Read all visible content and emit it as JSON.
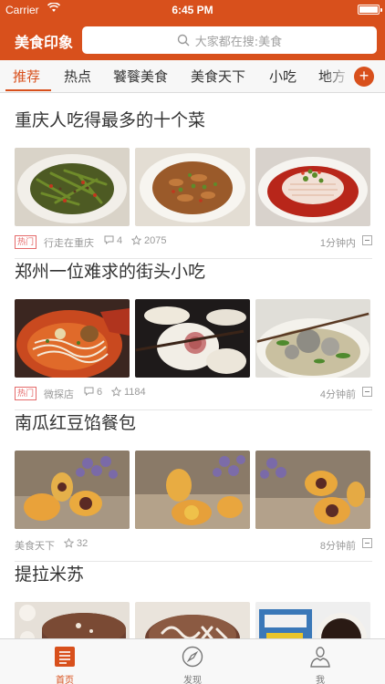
{
  "status_bar": {
    "carrier": "Carrier",
    "time": "6:45 PM"
  },
  "app": {
    "title": "美食印象"
  },
  "search": {
    "placeholder": "大家都在搜:美食"
  },
  "tabs": [
    {
      "label": "推荐",
      "active": true
    },
    {
      "label": "热点"
    },
    {
      "label": "饕餮美食"
    },
    {
      "label": "美食天下"
    },
    {
      "label": "小吃"
    },
    {
      "label": "地方"
    }
  ],
  "add_tab_label": "+",
  "articles": [
    {
      "title": "重庆人吃得最多的十个菜",
      "badge": "热门",
      "source": "行走在重庆",
      "comments": "4",
      "stars": "2075",
      "time": "1分钟内"
    },
    {
      "title": "郑州一位难求的街头小吃",
      "badge": "热门",
      "source": "微探店",
      "comments": "6",
      "stars": "1184",
      "time": "4分钟前"
    },
    {
      "title": "南瓜红豆馅餐包",
      "source": "美食天下",
      "stars": "32",
      "time": "8分钟前"
    },
    {
      "title": "提拉米苏"
    }
  ],
  "bottom_tabs": [
    {
      "label": "首页",
      "icon": "news-icon",
      "active": true
    },
    {
      "label": "发现",
      "icon": "compass-icon"
    },
    {
      "label": "我",
      "icon": "profile-icon"
    }
  ],
  "colors": {
    "accent": "#d8501c",
    "hot_badge": "#e56a6a"
  }
}
